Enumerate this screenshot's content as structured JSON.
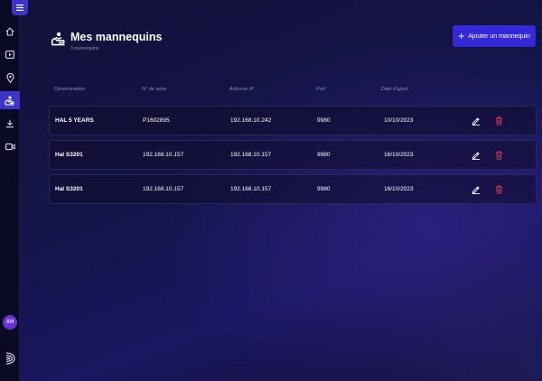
{
  "sidebar": {
    "menu_icon": "hamburger-menu-icon",
    "items": [
      {
        "name": "home",
        "icon": "home-icon"
      },
      {
        "name": "media",
        "icon": "play-box-icon"
      },
      {
        "name": "location",
        "icon": "location-pin-icon"
      },
      {
        "name": "mannequins",
        "icon": "mannequin-hand-icon",
        "active": true
      },
      {
        "name": "download",
        "icon": "download-icon"
      },
      {
        "name": "video",
        "icon": "video-camera-icon"
      }
    ],
    "avatar_initials": "AH",
    "brand_icon": "brand-logo-icon"
  },
  "header": {
    "title": "Mes mannequins",
    "subtitle": "3 mannequins",
    "add_button_label": "Ajouter un mannequin"
  },
  "table": {
    "columns": [
      "Dénomination",
      "N° de série",
      "Adresse IP",
      "Port",
      "Date d'ajout"
    ],
    "rows": [
      {
        "name": "HAL 5 YEARS",
        "serial": "P1602895",
        "ip": "192.168.10.242",
        "port": "9980",
        "date": "10/10/2023"
      },
      {
        "name": "Hal S3201",
        "serial": "192.168.10.157",
        "ip": "192.168.10.157",
        "port": "9980",
        "date": "16/10/2023"
      },
      {
        "name": "Hal S3201",
        "serial": "192.168.10.157",
        "ip": "192.168.10.157",
        "port": "9980",
        "date": "16/10/2023"
      }
    ]
  },
  "colors": {
    "accent": "#3528d6",
    "delete": "#d63a56",
    "avatar": "#6a33d8",
    "background": "#15144a"
  }
}
